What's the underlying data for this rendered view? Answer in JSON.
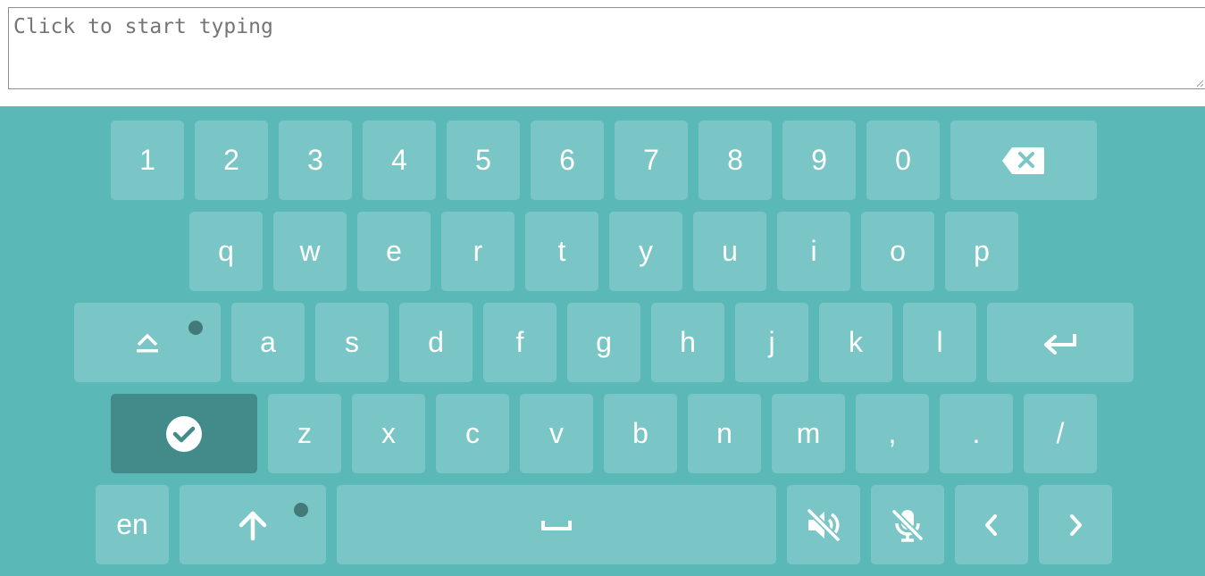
{
  "input": {
    "placeholder": "Click to start typing",
    "value": ""
  },
  "keyboard": {
    "row1": [
      "1",
      "2",
      "3",
      "4",
      "5",
      "6",
      "7",
      "8",
      "9",
      "0"
    ],
    "row2": [
      "q",
      "w",
      "e",
      "r",
      "t",
      "y",
      "u",
      "i",
      "o",
      "p"
    ],
    "row3": [
      "a",
      "s",
      "d",
      "f",
      "g",
      "h",
      "j",
      "k",
      "l"
    ],
    "row4": [
      "z",
      "x",
      "c",
      "v",
      "b",
      "n",
      "m",
      ",",
      ".",
      "/"
    ],
    "language": "en",
    "icons": {
      "backspace": "backspace-icon",
      "shift_lock": "shift-lock-icon",
      "enter": "enter-icon",
      "done": "checkmark-circle-icon",
      "shift": "arrow-up-icon",
      "space": "space-icon",
      "sound": "volume-mute-icon",
      "mic": "microphone-off-icon",
      "left": "chevron-left-icon",
      "right": "chevron-right-icon"
    }
  },
  "colors": {
    "keyboard_bg": "#5ab8b6",
    "key_bg": "#7ac6c6",
    "key_active_bg": "#428b8a",
    "indicator_dot": "#427a79"
  }
}
